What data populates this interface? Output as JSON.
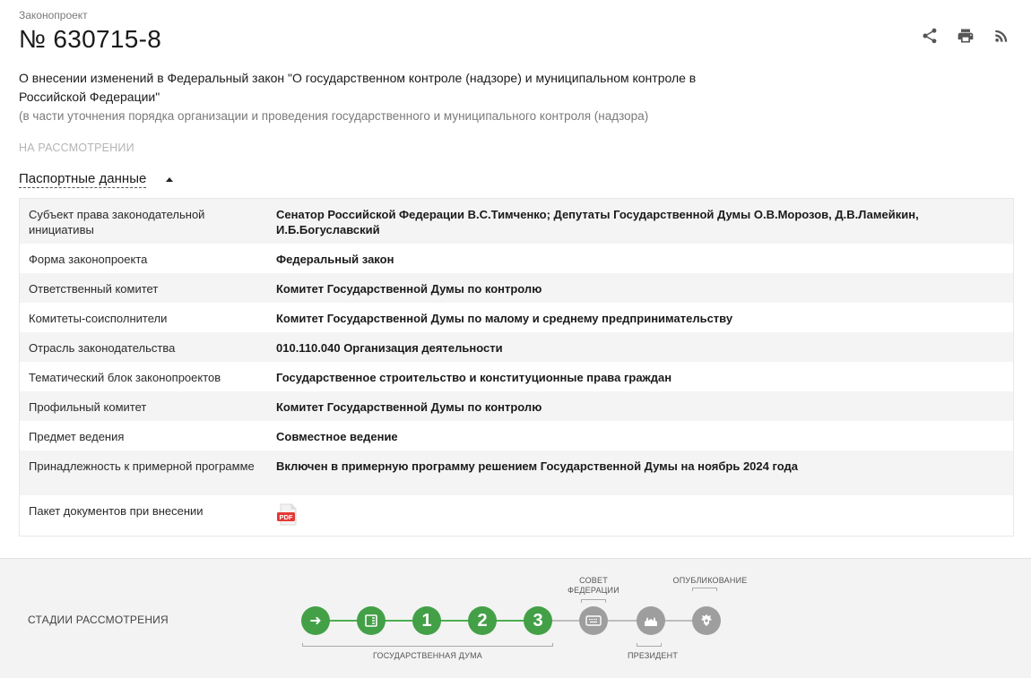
{
  "header": {
    "kicker": "Законопроект",
    "bill_number": "№ 630715-8",
    "title": "О внесении изменений в Федеральный закон \"О государственном контроле (надзоре) и муниципальном контроле в Российской Федерации\"",
    "subtitle": "(в части уточнения порядка организации и проведения государственного и муниципального контроля (надзора)",
    "status": "НА РАССМОТРЕНИИ",
    "actions": [
      "share-icon",
      "print-icon",
      "rss-icon"
    ]
  },
  "passport": {
    "toggle_label": "Паспортные данные",
    "rows": [
      {
        "key": "Субъект права законодательной инициативы",
        "value": "Сенатор Российской Федерации В.С.Тимченко; Депутаты Государственной Думы О.В.Морозов, Д.В.Ламейкин, И.Б.Богуславский"
      },
      {
        "key": "Форма законопроекта",
        "value": "Федеральный закон"
      },
      {
        "key": "Ответственный комитет",
        "value": "Комитет Государственной Думы по контролю"
      },
      {
        "key": "Комитеты-соисполнители",
        "value": "Комитет Государственной Думы по малому и среднему предпринимательству"
      },
      {
        "key": "Отрасль законодательства",
        "value": "010.110.040 Организация деятельности"
      },
      {
        "key": "Тематический блок законопроектов",
        "value": "Государственное строительство и конституционные права граждан"
      },
      {
        "key": "Профильный комитет",
        "value": "Комитет Государственной Думы по контролю"
      },
      {
        "key": "Предмет ведения",
        "value": "Совместное ведение"
      },
      {
        "key": "Принадлежность к примерной программе",
        "value": "Включен в примерную программу решением Государственной Думы на ноябрь 2024 года"
      },
      {
        "key": "Пакет документов при внесении",
        "value": ""
      }
    ],
    "pdf_label": "PDF"
  },
  "stages": {
    "label": "СТАДИИ РАССМОТРЕНИЯ",
    "steps": [
      {
        "id": "submitted",
        "symbol": "➜",
        "state": "done"
      },
      {
        "id": "preliminary",
        "symbol": "≡",
        "state": "done"
      },
      {
        "id": "reading-1",
        "symbol": "1",
        "state": "done"
      },
      {
        "id": "reading-2",
        "symbol": "2",
        "state": "done"
      },
      {
        "id": "reading-3",
        "symbol": "3",
        "state": "done"
      },
      {
        "id": "federation-council",
        "symbol": "",
        "state": "pending"
      },
      {
        "id": "president",
        "symbol": "",
        "state": "pending"
      },
      {
        "id": "publication",
        "symbol": "",
        "state": "pending"
      }
    ],
    "captions": {
      "duma": "ГОСУДАРСТВЕННАЯ ДУМА",
      "council_line1": "СОВЕТ",
      "council_line2": "ФЕДЕРАЦИИ",
      "president": "ПРЕЗИДЕНТ",
      "publication": "ОПУБЛИКОВАНИЕ"
    },
    "colors": {
      "done": "#43a047",
      "pending": "#9e9e9e"
    }
  }
}
